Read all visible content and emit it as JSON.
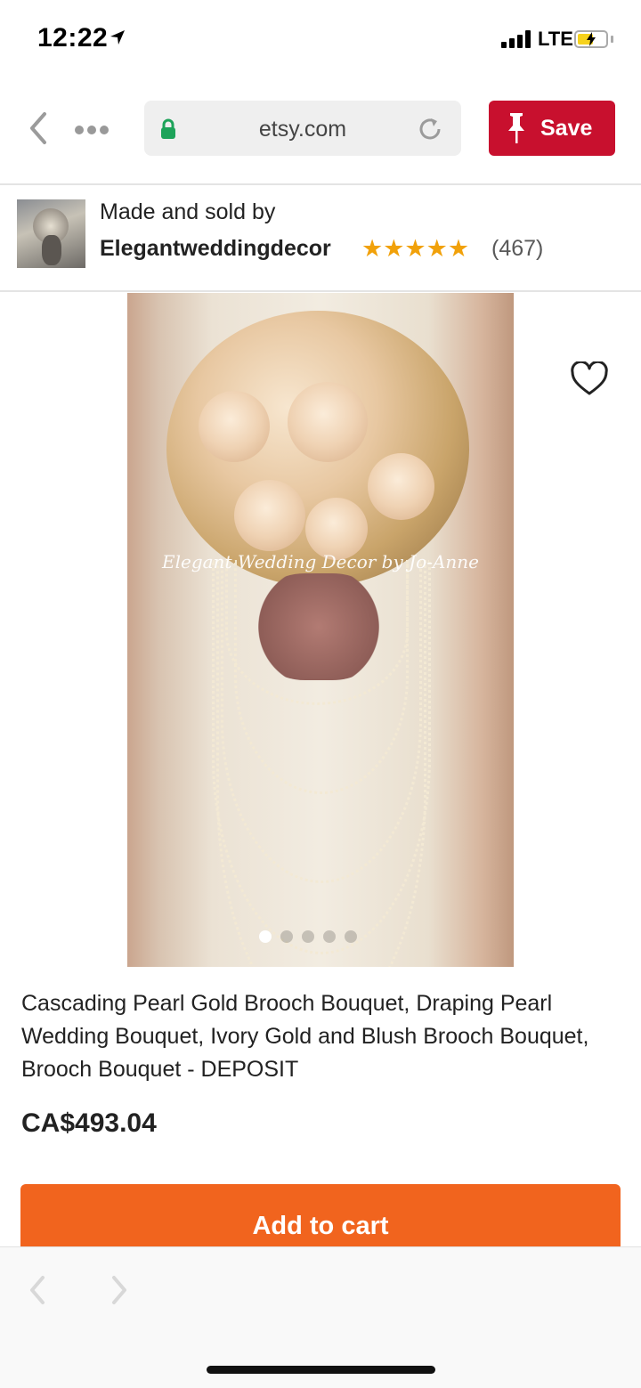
{
  "status_bar": {
    "time": "12:22",
    "network": "LTE"
  },
  "browser": {
    "url": "etsy.com",
    "save_label": "Save"
  },
  "seller": {
    "made_by": "Made and sold by",
    "shop_name": "Elegantweddingdecor",
    "stars": "★★★★★",
    "rating": 5,
    "reviews": "(467)"
  },
  "product": {
    "watermark": "Elegant Wedding Decor by Jo-Anne",
    "image_count": 5,
    "active_image": 1,
    "title": "Cascading Pearl Gold Brooch Bouquet, Draping Pearl Wedding Bouquet, Ivory Gold and Blush Brooch Bouquet, Brooch Bouquet - DEPOSIT",
    "price": "CA$493.04",
    "add_to_cart": "Add to cart"
  },
  "colors": {
    "save": "#c8102e",
    "cart": "#f1641e",
    "stars": "#f1a10a",
    "lock": "#1ea35a"
  },
  "icons": [
    "location-arrow-icon",
    "signal-icon",
    "battery-icon",
    "chevron-left-icon",
    "more-dots-icon",
    "lock-icon",
    "reload-icon",
    "pin-icon",
    "heart-icon",
    "chevron-right-icon"
  ]
}
